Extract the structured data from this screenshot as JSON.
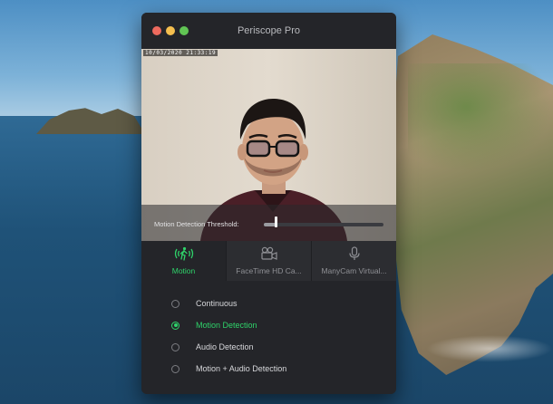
{
  "window": {
    "title": "Periscope Pro",
    "traffic_colors": {
      "close": "#ed6a5e",
      "minimize": "#f5bf4f",
      "zoom": "#61c554"
    }
  },
  "preview": {
    "timestamp": "10/03/2020  21:33:19",
    "threshold": {
      "label": "Motion Detection Threshold:",
      "value_fraction": 0.1
    }
  },
  "tabs": [
    {
      "label": "Motion",
      "icon": "motion-icon",
      "active": true
    },
    {
      "label": "FaceTime HD Ca...",
      "icon": "camera-icon",
      "active": false
    },
    {
      "label": "ManyCam Virtual...",
      "icon": "microphone-icon",
      "active": false
    }
  ],
  "options": [
    {
      "label": "Continuous",
      "selected": false
    },
    {
      "label": "Motion Detection",
      "selected": true
    },
    {
      "label": "Audio Detection",
      "selected": false
    },
    {
      "label": "Motion + Audio Detection",
      "selected": false
    }
  ],
  "colors": {
    "accent": "#2fd36a",
    "window_bg": "#242529"
  }
}
